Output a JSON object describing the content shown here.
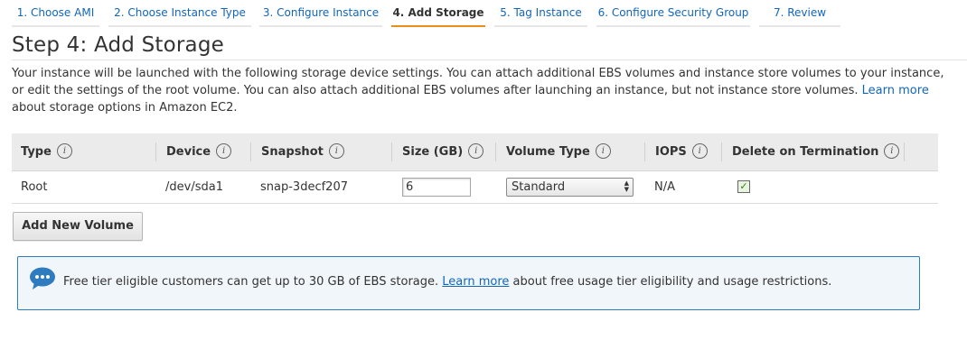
{
  "wizard": {
    "steps": [
      {
        "label": "1. Choose AMI"
      },
      {
        "label": "2. Choose Instance Type"
      },
      {
        "label": "3. Configure Instance"
      },
      {
        "label": "4. Add Storage"
      },
      {
        "label": "5. Tag Instance"
      },
      {
        "label": "6. Configure Security Group"
      },
      {
        "label": "7. Review"
      }
    ],
    "active_step": "4. Add Storage"
  },
  "page": {
    "title": "Step 4: Add Storage",
    "description_part1": "Your instance will be launched with the following storage device settings. You can attach additional EBS volumes and instance store volumes to your instance, or edit the settings of the root volume. You can also attach additional EBS volumes after launching an instance, but not instance store volumes. ",
    "learn_more": "Learn more",
    "description_part2": " about storage options in Amazon EC2."
  },
  "table": {
    "headers": [
      "Type",
      "Device",
      "Snapshot",
      "Size (GB)",
      "Volume Type",
      "IOPS",
      "Delete on Termination"
    ],
    "rows": [
      {
        "type": "Root",
        "device": "/dev/sda1",
        "snapshot": "snap-3decf207",
        "size": "6",
        "volume_type": "Standard",
        "iops": "N/A",
        "delete_on_termination": true
      }
    ]
  },
  "actions": {
    "add_volume_label": "Add New Volume"
  },
  "notice": {
    "text_part1": "Free tier eligible customers can get up to 30 GB of EBS storage. ",
    "link": "Learn more",
    "text_part2": " about free usage tier eligibility and usage restrictions."
  },
  "icons": {
    "info": "info-icon",
    "notice": "speech-bubble-icon",
    "select_arrows": "up-down-arrows-icon",
    "checkbox": "checkmark-icon"
  },
  "colors": {
    "link": "#1166bb",
    "active_step_underline": "#ee8c1a",
    "notice_border": "#2e7bbf",
    "notice_icon": "#2e7bbf"
  }
}
